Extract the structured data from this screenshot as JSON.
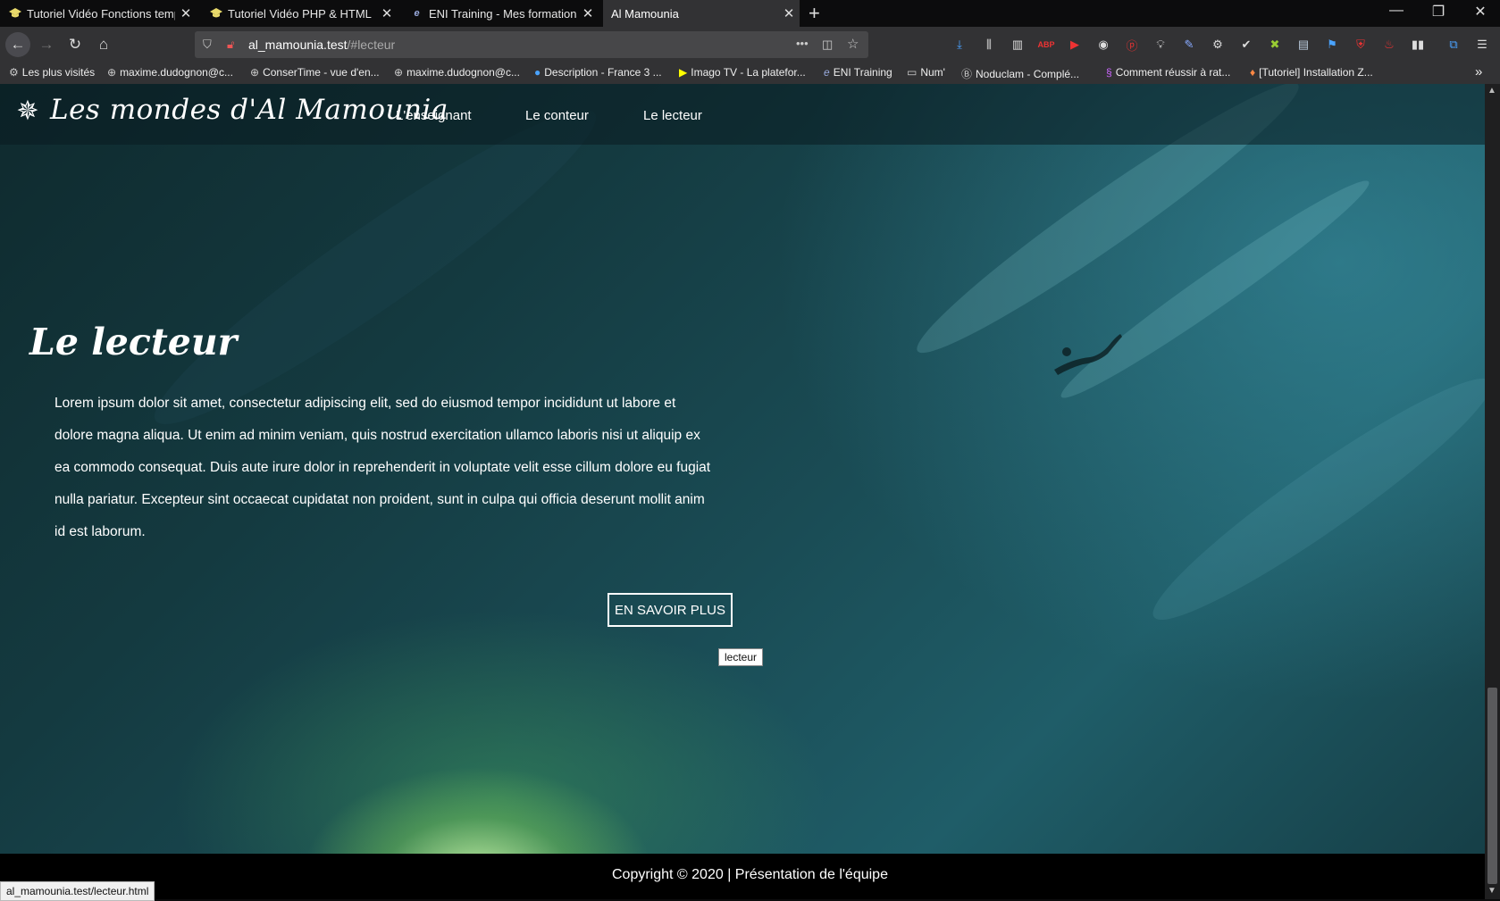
{
  "browser": {
    "tabs": [
      {
        "title": "Tutoriel Vidéo Fonctions temporelles",
        "close": "✕",
        "icon": "grad-cap-icon"
      },
      {
        "title": "Tutoriel Vidéo PHP & HTML",
        "close": "✕",
        "icon": "grad-cap-icon"
      },
      {
        "title": "ENI Training - Mes formations",
        "close": "✕",
        "icon": "eni-icon"
      },
      {
        "title": "Al Mamounia",
        "close": "✕",
        "icon": "none"
      }
    ],
    "new_tab": "+",
    "window": {
      "minimize": "—",
      "restore": "❐",
      "close": "✕"
    },
    "url_host": "al_mamounia.test",
    "url_path": "/#lecteur",
    "url_more": "•••",
    "bookmarks": [
      {
        "label": "Les plus visités",
        "icon": "gear-icon"
      },
      {
        "label": "maxime.dudognon@c...",
        "icon": "globe-icon"
      },
      {
        "label": "ConserTime - vue d'en...",
        "icon": "globe-icon"
      },
      {
        "label": "maxime.dudognon@c...",
        "icon": "globe-icon"
      },
      {
        "label": "Description - France 3 ...",
        "icon": "france3-icon"
      },
      {
        "label": "Imago TV - La platefor...",
        "icon": "imago-icon"
      },
      {
        "label": "ENI Training",
        "icon": "eni-icon"
      },
      {
        "label": "Num'",
        "icon": "folder-icon"
      },
      {
        "label": "Noduclam - Complé...",
        "icon": "b-icon"
      },
      {
        "label": "Comment réussir à rat...",
        "icon": "s-icon"
      },
      {
        "label": "[Tutoriel] Installation Z...",
        "icon": "fox-icon"
      }
    ],
    "bookmarks_overflow": "»",
    "status_url": "al_mamounia.test/lecteur.html"
  },
  "site": {
    "title": "Les mondes d'Al Mamounia",
    "nav": [
      "L'enseignant",
      "Le conteur",
      "Le lecteur"
    ],
    "section_heading": "Le lecteur",
    "section_text": "Lorem ipsum dolor sit amet, consectetur adipiscing elit, sed do eiusmod tempor incididunt ut labore et dolore magna aliqua. Ut enim ad minim veniam, quis nostrud exercitation ullamco laboris nisi ut aliquip ex ea commodo consequat. Duis aute irure dolor in reprehenderit in voluptate velit esse cillum dolore eu fugiat nulla pariatur. Excepteur sint occaecat cupidatat non proident, sunt in culpa qui officia deserunt mollit anim id est laborum.",
    "more_button": "EN SAVOIR PLUS",
    "tooltip": "lecteur",
    "footer": "Copyright © 2020 | Présentation de l'équipe"
  },
  "colors": {
    "chrome_dark": "#0c0c0d",
    "chrome": "#323234",
    "urlbar": "#474749",
    "page_bg": "#1a4c55",
    "footer": "#000000"
  }
}
